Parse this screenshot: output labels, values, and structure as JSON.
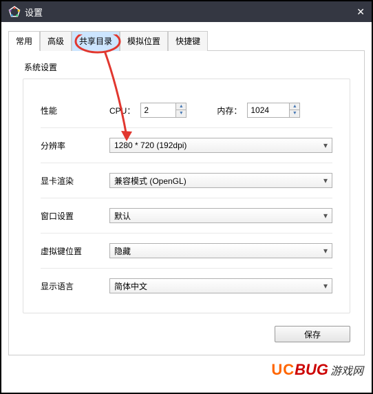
{
  "window": {
    "title": "设置"
  },
  "tabs": [
    {
      "label": "常用"
    },
    {
      "label": "高级"
    },
    {
      "label": "共享目录"
    },
    {
      "label": "模拟位置"
    },
    {
      "label": "快捷键"
    }
  ],
  "panel": {
    "group_title": "系统设置",
    "rows": {
      "perf": {
        "label": "性能",
        "cpu_label": "CPU：",
        "cpu_value": "2",
        "mem_label": "内存：",
        "mem_value": "1024"
      },
      "resolution": {
        "label": "分辨率",
        "value": "1280 * 720 (192dpi)"
      },
      "gpu": {
        "label": "显卡渲染",
        "value": "兼容模式 (OpenGL)"
      },
      "window": {
        "label": "窗口设置",
        "value": "默认"
      },
      "vk": {
        "label": "虚拟键位置",
        "value": "隐藏"
      },
      "lang": {
        "label": "显示语言",
        "value": "简体中文"
      }
    }
  },
  "footer": {
    "save_label": "保存"
  },
  "watermark": {
    "uc": "UC",
    "bug": "BUG",
    "cn": "游戏网"
  }
}
